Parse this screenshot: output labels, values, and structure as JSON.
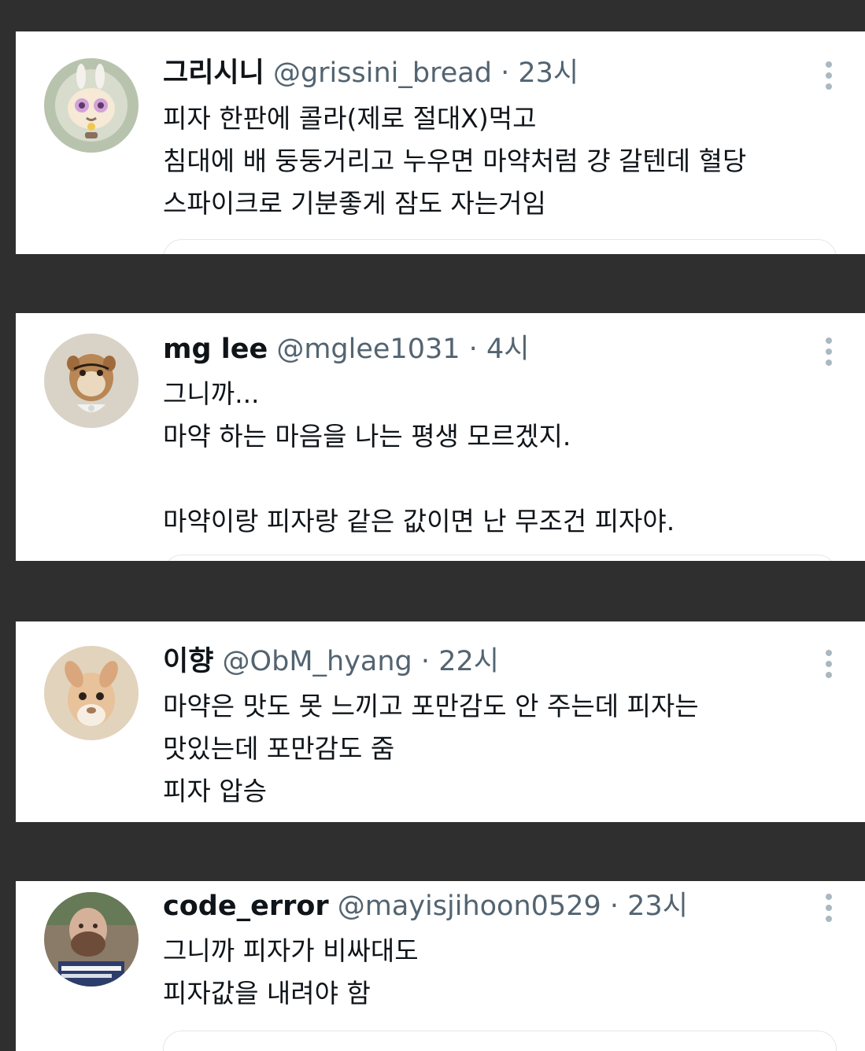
{
  "tweets": [
    {
      "name": "그리시니",
      "handle": "@grissini_bread",
      "separator": "·",
      "time": "23시",
      "lines": [
        "피자 한판에 콜라(제로 절대X)먹고",
        "침대에 배 둥둥거리고 누우면 마약처럼 걍 갈텐데 혈당",
        "스파이크로 기분좋게 잠도 자는거임"
      ],
      "avatar_icon": "cartoon-bunny-avatar",
      "colors": {
        "avatar_bg": "#b8c3ad"
      }
    },
    {
      "name": "mg lee",
      "handle": "@mglee1031",
      "separator": "·",
      "time": "4시",
      "lines": [
        "그니까...",
        "마약 하는 마음을 나는 평생 모르겠지.",
        "",
        "마약이랑 피자랑 같은 값이면 난 무조건 피자야."
      ],
      "avatar_icon": "chipmunk-avatar",
      "colors": {
        "avatar_bg": "#d9d3c7"
      }
    },
    {
      "name": "이향",
      "handle": "@ObM_hyang",
      "separator": "·",
      "time": "22시",
      "lines": [
        "마약은 맛도 못 느끼고 포만감도 안 주는데 피자는",
        "맛있는데 포만감도 줌",
        "피자 압승"
      ],
      "avatar_icon": "deer-fawn-avatar",
      "colors": {
        "avatar_bg": "#e2d3bd"
      }
    },
    {
      "name": "code_error",
      "handle": "@mayisjihoon0529",
      "separator": "·",
      "time": "23시",
      "lines": [
        "그니까 피자가 비싸대도",
        "피자값을 내려야 함"
      ],
      "avatar_icon": "bearded-man-avatar",
      "colors": {
        "avatar_bg": "#8a7a68"
      }
    }
  ],
  "icons": {
    "more": "more-options-icon"
  }
}
